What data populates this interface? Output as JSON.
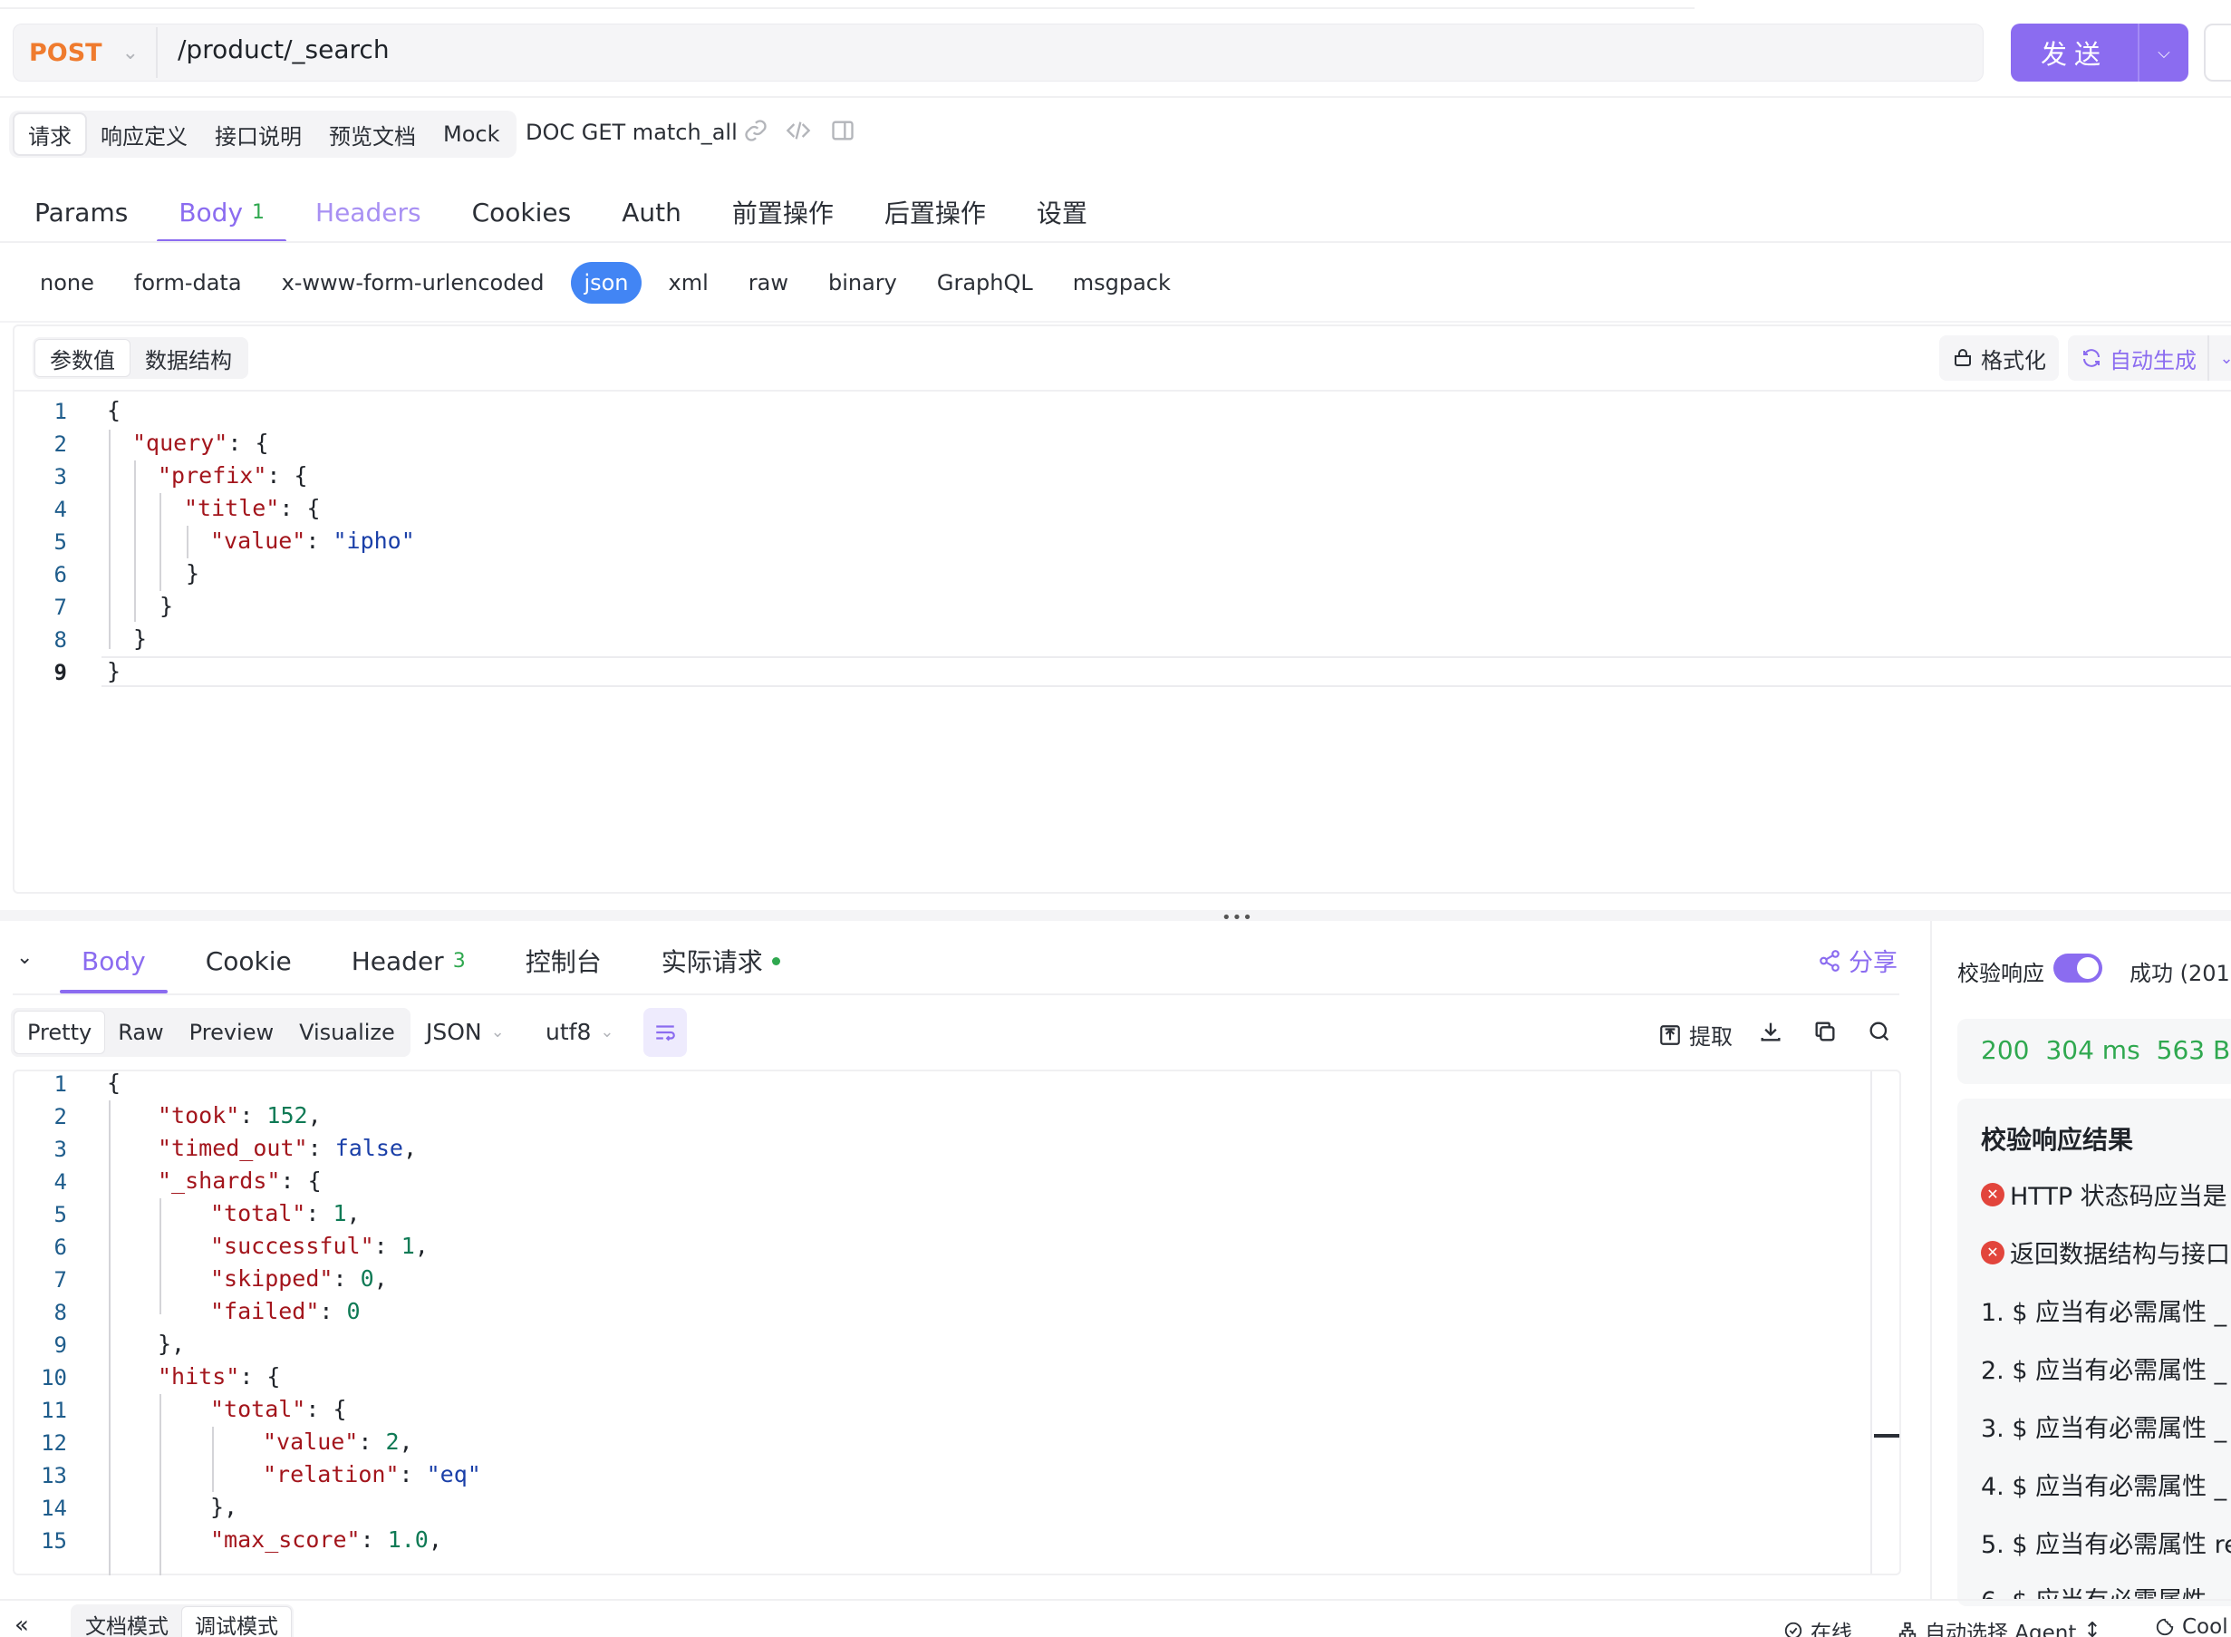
{
  "request": {
    "method": "POST",
    "url": "/product/_search",
    "send_label": "发送"
  },
  "subtabs": {
    "items": [
      "请求",
      "响应定义",
      "接口说明",
      "预览文档",
      "Mock"
    ],
    "doc_name": "DOC GET match_all"
  },
  "req_tabs": [
    {
      "label": "Params"
    },
    {
      "label": "Body",
      "count": "1"
    },
    {
      "label": "Headers"
    },
    {
      "label": "Cookies"
    },
    {
      "label": "Auth"
    },
    {
      "label": "前置操作"
    },
    {
      "label": "后置操作"
    },
    {
      "label": "设置"
    }
  ],
  "body_types": [
    "none",
    "form-data",
    "x-www-form-urlencoded",
    "json",
    "xml",
    "raw",
    "binary",
    "GraphQL",
    "msgpack"
  ],
  "editor": {
    "seg": [
      "参数值",
      "数据结构"
    ],
    "format_label": "格式化",
    "autogen_label": "自动生成",
    "line_numbers": [
      "1",
      "2",
      "3",
      "4",
      "5",
      "6",
      "7",
      "8",
      "9"
    ]
  },
  "response": {
    "tabs": [
      {
        "label": "Body"
      },
      {
        "label": "Cookie"
      },
      {
        "label": "Header",
        "count": "3"
      },
      {
        "label": "控制台"
      },
      {
        "label": "实际请求"
      }
    ],
    "share_label": "分享",
    "view_modes": [
      "Pretty",
      "Raw",
      "Preview",
      "Visualize"
    ],
    "format": "JSON",
    "encoding": "utf8",
    "extract_label": "提取",
    "line_numbers": [
      "1",
      "2",
      "3",
      "4",
      "5",
      "6",
      "7",
      "8",
      "9",
      "10",
      "11",
      "12",
      "13",
      "14",
      "15"
    ]
  },
  "validation": {
    "label": "校验响应",
    "success_label": "成功 (201",
    "status_code": "200",
    "time": "304 ms",
    "size": "563 B",
    "result_title": "校验响应结果",
    "errors": [
      "HTTP 状态码应当是",
      "返回数据结构与接口"
    ],
    "items": [
      "1. $ 应当有必需属性 _",
      "2. $ 应当有必需属性 _",
      "3. $ 应当有必需属性 _",
      "4. $ 应当有必需属性 _",
      "5. $ 应当有必需属性 re",
      "6. $ 应当有必需属性"
    ]
  },
  "bottom": {
    "modes": [
      "文档模式",
      "调试模式"
    ],
    "online": "在线",
    "agent": "自动选择 Agent",
    "cookie": "Cool"
  },
  "colors": {
    "accent": "#8b6cf0",
    "method": "#ef7b2e",
    "success": "#2fa84f",
    "error": "#e2453c",
    "json_active": "#4285f4"
  }
}
